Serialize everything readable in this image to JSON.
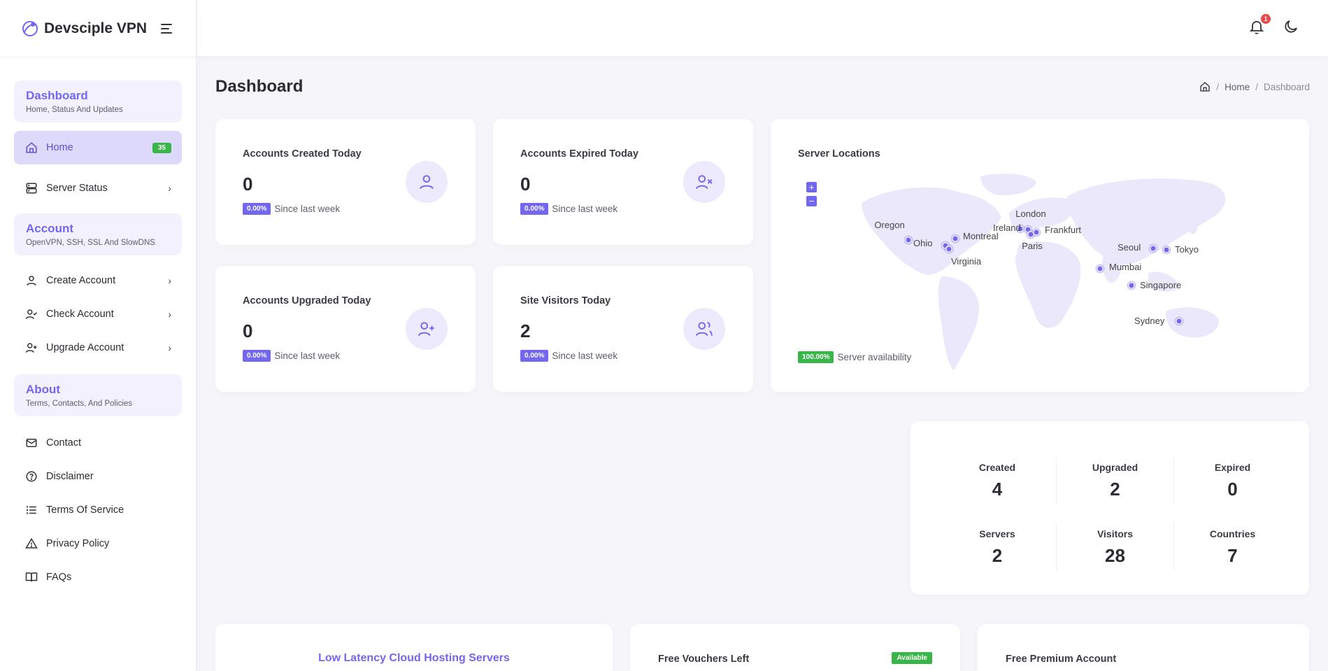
{
  "brand": {
    "name": "Devsciple VPN"
  },
  "topbar": {
    "notification_count": "1"
  },
  "sidebar": {
    "sections": {
      "dashboard": {
        "title": "Dashboard",
        "subtitle": "Home, Status And Updates"
      },
      "account": {
        "title": "Account",
        "subtitle": "OpenVPN, SSH, SSL And SlowDNS"
      },
      "about": {
        "title": "About",
        "subtitle": "Terms, Contacts, And Policies"
      }
    },
    "items": {
      "home": {
        "label": "Home",
        "badge": "35"
      },
      "server_status": {
        "label": "Server Status"
      },
      "create_account": {
        "label": "Create Account"
      },
      "check_account": {
        "label": "Check Account"
      },
      "upgrade_account": {
        "label": "Upgrade Account"
      },
      "contact": {
        "label": "Contact"
      },
      "disclaimer": {
        "label": "Disclaimer"
      },
      "terms": {
        "label": "Terms Of Service"
      },
      "privacy": {
        "label": "Privacy Policy"
      },
      "faqs": {
        "label": "FAQs"
      }
    }
  },
  "page": {
    "title": "Dashboard",
    "breadcrumb": {
      "home": "Home",
      "sep": "/",
      "current": "Dashboard"
    }
  },
  "stats": {
    "created": {
      "title": "Accounts Created Today",
      "value": "0",
      "pct": "0.00%",
      "since": "Since last week"
    },
    "expired": {
      "title": "Accounts Expired Today",
      "value": "0",
      "pct": "0.00%",
      "since": "Since last week"
    },
    "upgraded": {
      "title": "Accounts Upgraded Today",
      "value": "0",
      "pct": "0.00%",
      "since": "Since last week"
    },
    "visitors": {
      "title": "Site Visitors Today",
      "value": "2",
      "pct": "0.00%",
      "since": "Since last week"
    }
  },
  "map": {
    "title": "Server Locations",
    "zoom_in": "+",
    "zoom_out": "−",
    "availability_pct": "100.00%",
    "availability_label": "Server availability",
    "marker_color": "#7367f0",
    "locations": [
      "Oregon",
      "Ohio",
      "Virginia",
      "Montreal",
      "Ireland",
      "London",
      "Paris",
      "Frankfurt",
      "Mumbai",
      "Singapore",
      "Seoul",
      "Tokyo",
      "Sydney"
    ]
  },
  "summary": [
    {
      "label": "Created",
      "value": "4"
    },
    {
      "label": "Upgraded",
      "value": "2"
    },
    {
      "label": "Expired",
      "value": "0"
    },
    {
      "label": "Servers",
      "value": "2"
    },
    {
      "label": "Visitors",
      "value": "28"
    },
    {
      "label": "Countries",
      "value": "7"
    }
  ],
  "bottom": {
    "hosting_title": "Low Latency Cloud Hosting Servers",
    "vouchers_title": "Free Vouchers Left",
    "vouchers_badge": "Available",
    "premium_title": "Free Premium Account"
  },
  "colors": {
    "accent": "#7367f0",
    "success": "#39b54a",
    "danger": "#ea4a4a"
  }
}
